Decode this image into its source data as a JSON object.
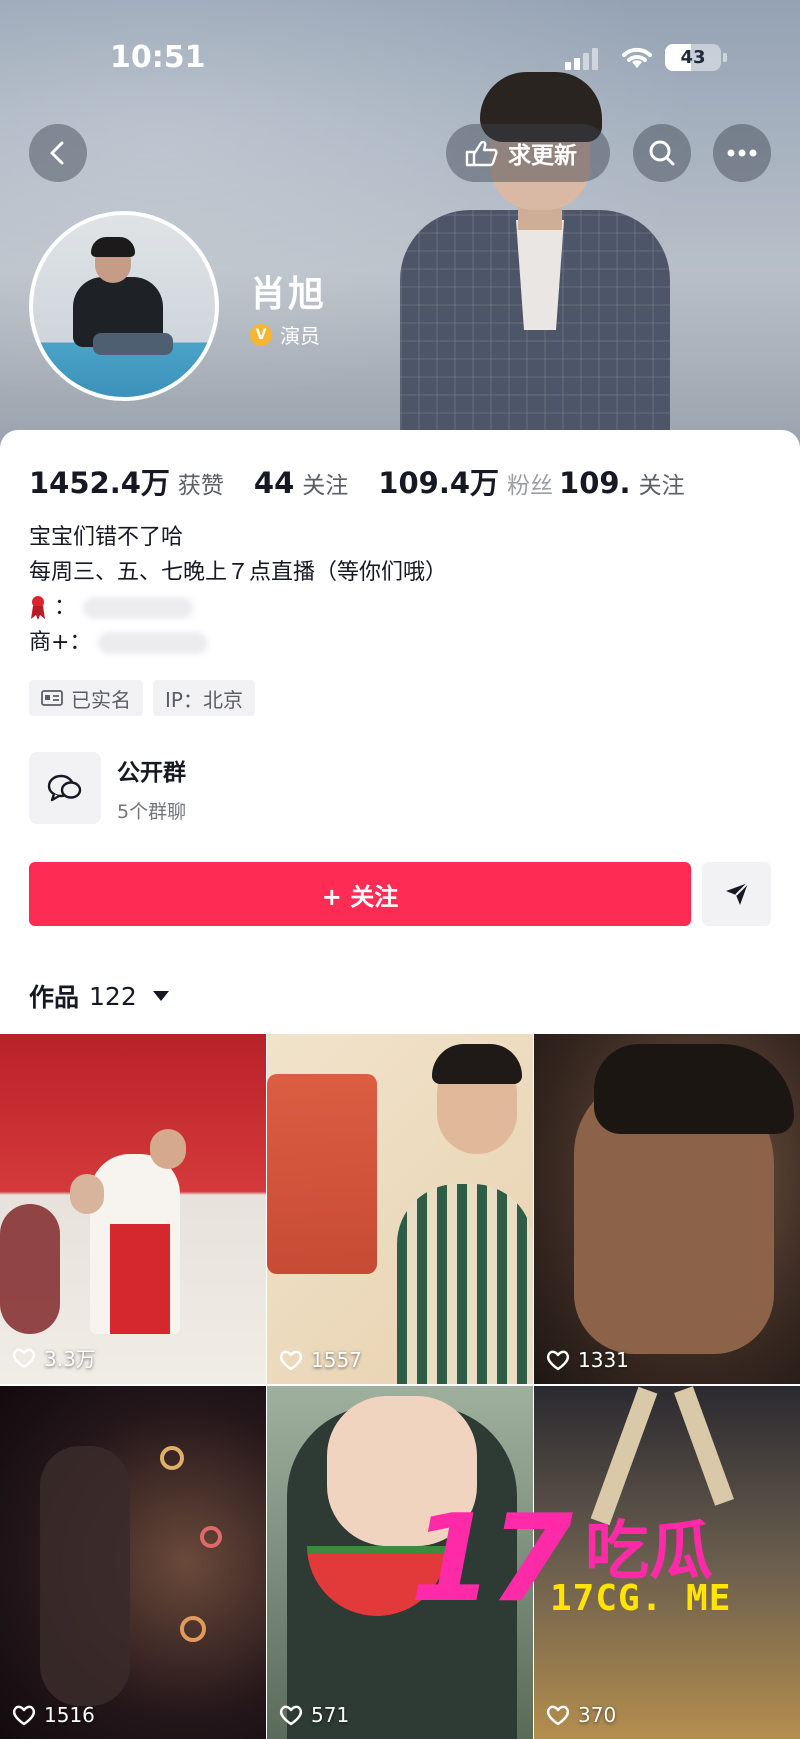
{
  "status_bar": {
    "time": "10:51",
    "battery": "43"
  },
  "header": {
    "update_label": "求更新"
  },
  "profile": {
    "name": "肖旭",
    "verified_title": "演员"
  },
  "stats": [
    {
      "value": "1452.4万",
      "label": "获赞"
    },
    {
      "value": "44",
      "label": "关注"
    },
    {
      "value": "109.4万",
      "label": "粉丝"
    },
    {
      "value": "109.",
      "label": "关注"
    }
  ],
  "bio": {
    "line1": "宝宝们错不了哈",
    "line2": "每周三、五、七晚上７点直播（等你们哦）",
    "line3_prefix": "：",
    "line4_prefix": "商+："
  },
  "tags": {
    "real_name": "已实名",
    "ip": "IP：北京"
  },
  "group": {
    "title": "公开群",
    "subtitle": "5个群聊"
  },
  "actions": {
    "follow_label": "+ 关注"
  },
  "works": {
    "label": "作品",
    "count": "122"
  },
  "videos": [
    {
      "likes": "3.3万"
    },
    {
      "likes": "1557"
    },
    {
      "likes": "1331"
    },
    {
      "likes": "1516"
    },
    {
      "likes": "571"
    },
    {
      "likes": "370"
    }
  ],
  "watermark": {
    "number": "17",
    "chinese": "吃瓜",
    "url": "17CG. ME"
  },
  "colors": {
    "follow": "#fe2c55",
    "verified": "#f6b62d",
    "watermark_pink": "#ff2aa8",
    "watermark_yellow": "#ffe400"
  }
}
